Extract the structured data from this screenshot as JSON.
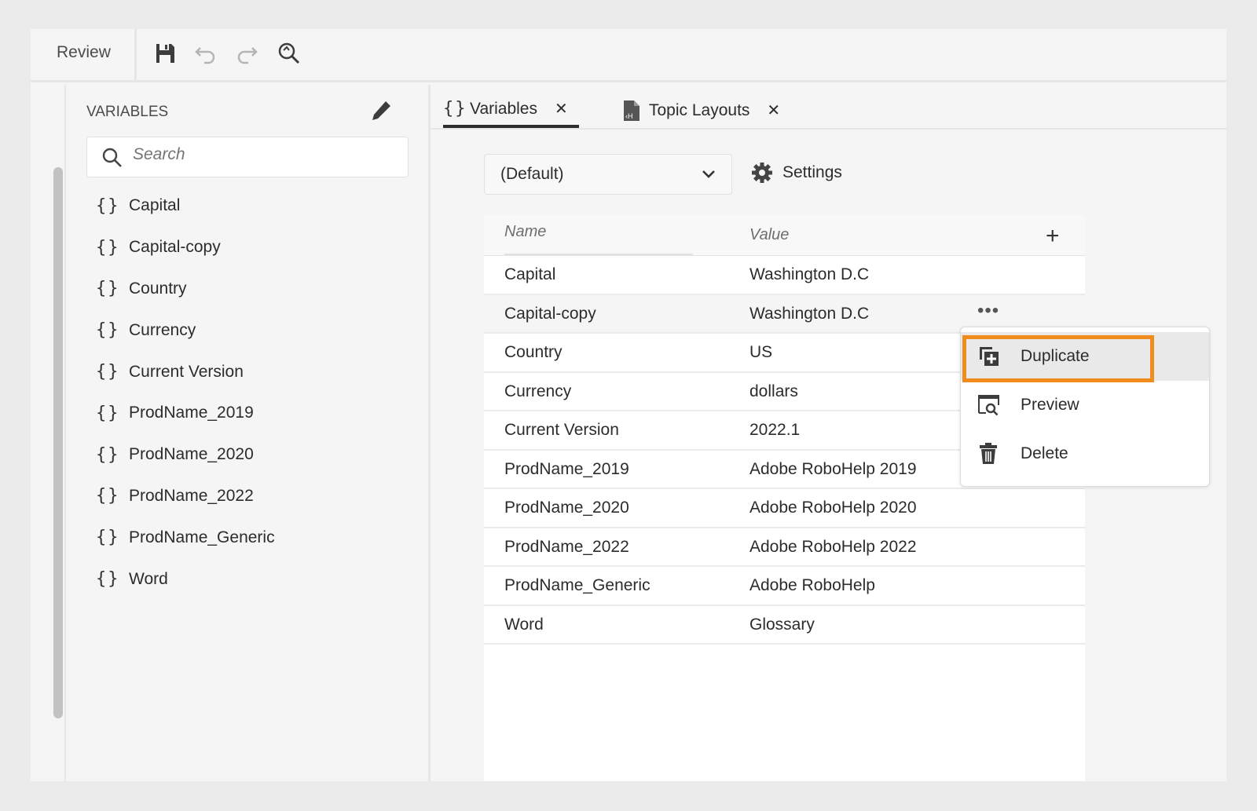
{
  "toolbar": {
    "review_label": "Review",
    "icons": [
      "save-icon",
      "undo-icon",
      "redo-icon",
      "find-replace-icon"
    ]
  },
  "sidebar": {
    "title": "VARIABLES",
    "search_placeholder": "Search",
    "items": [
      "Capital",
      "Capital-copy",
      "Country",
      "Currency",
      "Current Version",
      "ProdName_2019",
      "ProdName_2020",
      "ProdName_2022",
      "ProdName_Generic",
      "Word"
    ]
  },
  "tabs": [
    {
      "label": "Variables",
      "icon": "braces-icon",
      "active": true
    },
    {
      "label": "Topic Layouts",
      "icon": "file-layout-icon",
      "active": false
    }
  ],
  "brace": "{}",
  "close": "✕",
  "main": {
    "dropdown_value": "(Default)",
    "settings_label": "Settings",
    "columns": {
      "name": "Name",
      "value": "Value"
    },
    "rows": [
      {
        "name": "Capital",
        "value": "Washington D.C"
      },
      {
        "name": "Capital-copy",
        "value": "Washington D.C"
      },
      {
        "name": "Country",
        "value": "US"
      },
      {
        "name": "Currency",
        "value": "dollars"
      },
      {
        "name": "Current Version",
        "value": "2022.1"
      },
      {
        "name": "ProdName_2019",
        "value": "Adobe RoboHelp 2019"
      },
      {
        "name": "ProdName_2020",
        "value": "Adobe RoboHelp 2020"
      },
      {
        "name": "ProdName_2022",
        "value": "Adobe RoboHelp 2022"
      },
      {
        "name": "ProdName_Generic",
        "value": "Adobe RoboHelp"
      },
      {
        "name": "Word",
        "value": "Glossary"
      }
    ],
    "more_label": "•••",
    "add_label": "+"
  },
  "context_menu": {
    "items": [
      "Duplicate",
      "Preview",
      "Delete"
    ],
    "highlight_color": "#f08c1e"
  }
}
